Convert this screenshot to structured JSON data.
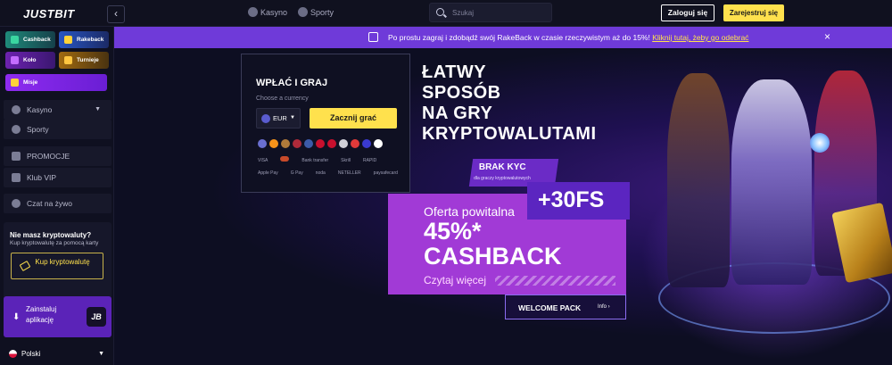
{
  "header": {
    "logo": "JUSTBIT",
    "collapse_icon": "‹",
    "nav": [
      {
        "label": "Kasyno"
      },
      {
        "label": "Sporty"
      }
    ],
    "search_placeholder": "Szukaj",
    "login_label": "Zaloguj się",
    "register_label": "Zarejestruj się"
  },
  "sidebar": {
    "tiles": [
      {
        "label": "Cashback"
      },
      {
        "label": "Rakeback"
      },
      {
        "label": "Koło"
      },
      {
        "label": "Turnieje"
      },
      {
        "label": "Misje"
      }
    ],
    "items": [
      {
        "label": "Kasyno"
      },
      {
        "label": "Sporty"
      },
      {
        "label": "PROMOCJE"
      },
      {
        "label": "Klub VIP"
      },
      {
        "label": "Czat na żywo"
      }
    ],
    "crypto": {
      "title": "Nie masz kryptowaluty?",
      "subtitle": "Kup kryptowalutę za pomocą karty",
      "button_label": "Kup kryptowalutę"
    },
    "install": {
      "label": "Zainstaluj aplikację",
      "badge": "JB"
    },
    "language": "Polski"
  },
  "announcement": {
    "text": "Po prostu zagraj i zdobądź swój RakeBack w czasie rzeczywistym aż do 15%!",
    "link": "Kliknij tutaj, żeby go odebrać",
    "close": "×"
  },
  "deposit": {
    "title": "WPŁAĆ I GRAJ",
    "subtitle": "Choose a currency",
    "currency": "EUR",
    "button_label": "Zacznij grać",
    "coin_colors": [
      "#6a6fd0",
      "#f7931a",
      "#b07a3a",
      "#ae2a3a",
      "#3c5ba8",
      "#c8102e",
      "#c8102e",
      "#d0d0d8",
      "#e03a3a",
      "#3a3ad0",
      "#ffffff"
    ],
    "payment_rows": [
      [
        "VISA",
        "",
        "Bank transfer",
        "Skrill",
        "RAPID"
      ],
      [
        "Apple Pay",
        "G Pay",
        "noda",
        "NETELLER",
        "paysafecard"
      ]
    ]
  },
  "hero": {
    "headline": [
      "ŁATWY",
      "SPOSÓB",
      "NA GRY",
      "KRYPTOWALUTAMI"
    ],
    "kyc_title": "BRAK KYC",
    "kyc_subtitle": "dla graczy kryptowalutowych",
    "free_spins": "+30FS",
    "offer_line1": "Oferta powitalna",
    "offer_percent": "45%*",
    "offer_cashback": "CASHBACK",
    "read_more": "Czytaj więcej",
    "welcome_pack": "WELCOME PACK",
    "welcome_info": "Info"
  }
}
